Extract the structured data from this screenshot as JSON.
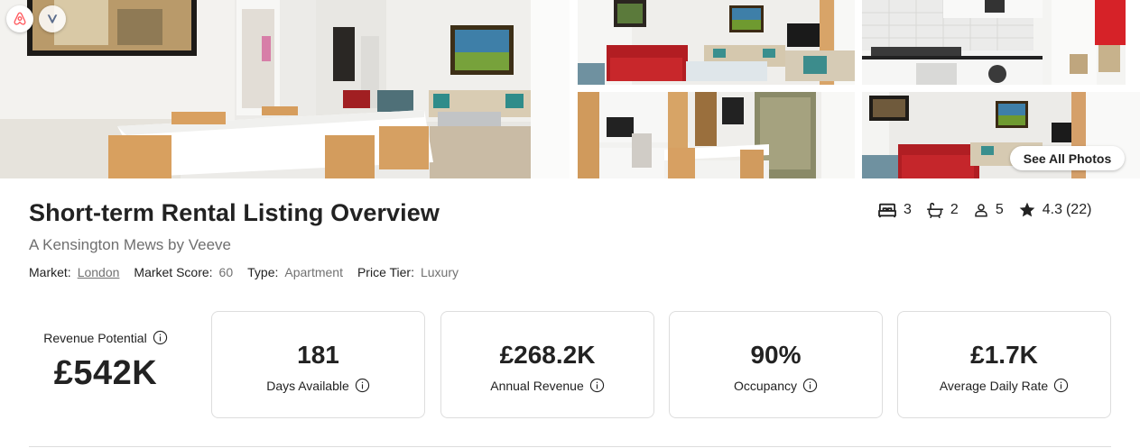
{
  "gallery": {
    "photos": [
      "dining-room",
      "living-room",
      "kitchen",
      "study",
      "living-room-2"
    ],
    "see_all_label": "See All Photos",
    "badges": [
      "airbnb-logo",
      "vrbo-logo"
    ]
  },
  "listing": {
    "title": "Short-term Rental Listing Overview",
    "subtitle": "A Kensington Mews by Veeve",
    "market_label": "Market:",
    "market_value": "London",
    "score_label": "Market Score:",
    "score_value": "60",
    "type_label": "Type:",
    "type_value": "Apartment",
    "tier_label": "Price Tier:",
    "tier_value": "Luxury"
  },
  "stats": {
    "bedrooms": "3",
    "bathrooms": "2",
    "guests": "5",
    "rating": "4.3",
    "reviews": "(22)"
  },
  "revenue": {
    "potential_label": "Revenue Potential",
    "potential_value": "£542K",
    "cards": [
      {
        "value": "181",
        "label": "Days Available"
      },
      {
        "value": "£268.2K",
        "label": "Annual Revenue"
      },
      {
        "value": "90%",
        "label": "Occupancy"
      },
      {
        "value": "£1.7K",
        "label": "Average Daily Rate"
      }
    ]
  },
  "colors": {
    "text": "#222222",
    "muted": "#717171",
    "border": "#dddddd",
    "airbnb": "#ff5a5f"
  }
}
